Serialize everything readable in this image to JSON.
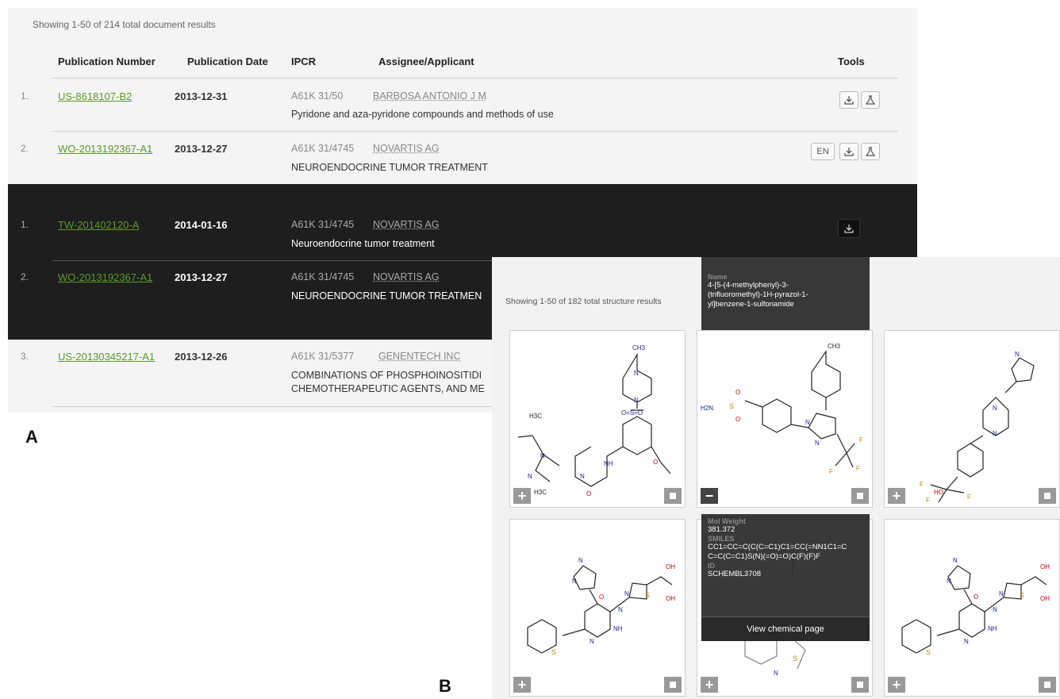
{
  "panelA": {
    "label": "A",
    "results_info": "Showing 1-50  of 214 total document results",
    "headers": {
      "pubnum": "Publication Number",
      "pubdate": "Publication Date",
      "ipcr": "IPCR",
      "assignee": "Assignee/Applicant",
      "tools": "Tools"
    },
    "rows": [
      {
        "num": "1.",
        "pubnum": "US-8618107-B2",
        "date": "2013-12-31",
        "ipcr": "A61K 31/50",
        "assignee": "BARBOSA ANTONIO J M",
        "title": "Pyridone and aza-pyridone compounds and methods of use"
      },
      {
        "num": "2.",
        "pubnum": "WO-2013192367-A1",
        "date": "2013-12-27",
        "ipcr": "A61K 31/4745",
        "assignee": "NOVARTIS AG",
        "title": "NEUROENDOCRINE TUMOR TREATMENT",
        "lang": "EN"
      }
    ],
    "family_rows": [
      {
        "num": "1.",
        "pubnum": "TW-201402120-A",
        "date": "2014-01-16",
        "ipcr": "A61K 31/4745",
        "assignee": "NOVARTIS AG",
        "title": "Neuroendocrine tumor treatment"
      },
      {
        "num": "2.",
        "pubnum": "WO-2013192367-A1",
        "date": "2013-12-27",
        "ipcr": "A61K 31/4745",
        "assignee": "NOVARTIS AG",
        "title": "NEUROENDOCRINE TUMOR TREATMEN"
      }
    ],
    "row3": {
      "num": "3.",
      "pubnum": "US-20130345217-A1",
      "date": "2013-12-26",
      "ipcr": "A61K 31/5377",
      "assignee": "GENENTECH INC",
      "title1": "COMBINATIONS OF PHOSPHOINOSITIDI",
      "title2": "CHEMOTHERAPEUTIC AGENTS, AND ME"
    }
  },
  "panelB": {
    "label": "B",
    "results_info": "Showing 1-50  of 182 total structure results",
    "tooltip_top": {
      "name_key": "Name",
      "name_value": "4-[5-(4-methylphenyl)-3-(trifluoromethyl)-1H-pyrazol-1-yl]benzene-1-sulfonamide"
    },
    "tooltip_bottom": {
      "mw_key": "Mol Weight",
      "mw_value": "381.372",
      "smiles_key": "SMILES",
      "smiles_value": "CC1=CC=C(C(C=C1)C1=CC(=NN1C1=CC=C(C=C1)S(N)(=O)=O)C(F)(F)F",
      "id_key": "ID",
      "id_value": "SCHEMBL3708",
      "view_button": "View chemical page"
    },
    "card_buttons": {
      "plus": "+",
      "minus": "−"
    }
  }
}
